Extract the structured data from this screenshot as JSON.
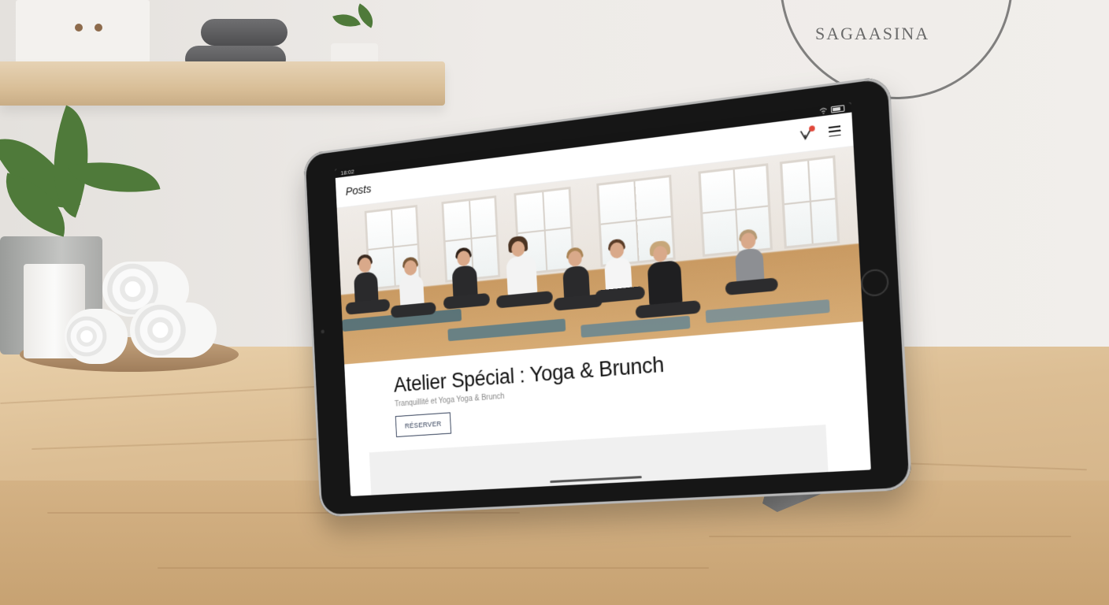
{
  "scene": {
    "wall_logo_text": "SAGAASINA"
  },
  "tablet": {
    "status": {
      "time": "18:02"
    },
    "app": {
      "title": "Posts",
      "notification_icon": "sparkle-notification-icon",
      "menu_icon": "hamburger-menu-icon"
    },
    "post": {
      "title": "Atelier Spécial : Yoga & Brunch",
      "subtitle": "Tranquillité et Yoga Yoga & Brunch",
      "reserve_label": "RÉSERVER"
    }
  },
  "colors": {
    "accent_button": "#2e3b55",
    "badge": "#e0473a"
  }
}
